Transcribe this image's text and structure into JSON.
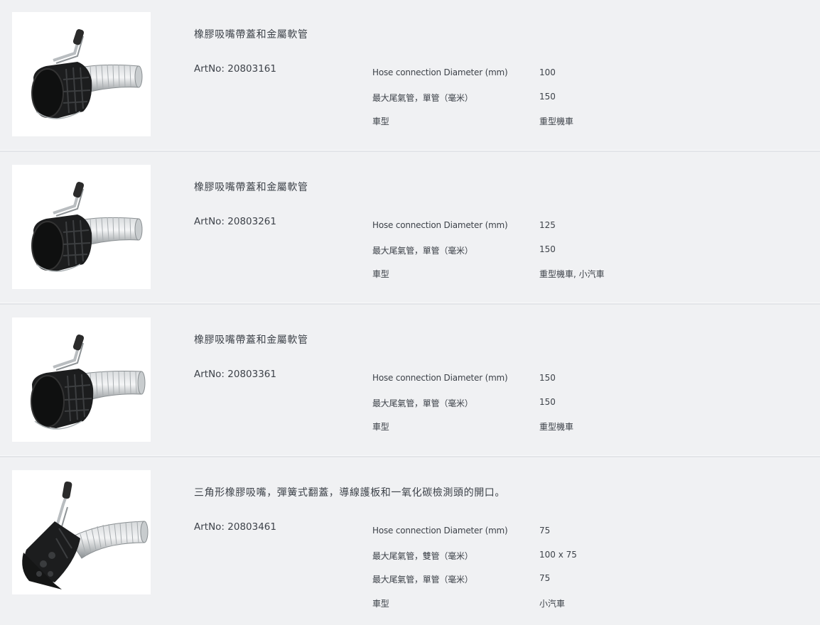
{
  "products": [
    {
      "title": "橡膠吸嘴帶蓋和金屬軟管",
      "artno": "ArtNo: 20803161",
      "image_icon": "rubber-nozzle-with-lid-and-metal-hose-icon",
      "specs": [
        {
          "label": "Hose connection Diameter (mm)",
          "value": "100"
        },
        {
          "label": "最大尾氣管，單管（毫米）",
          "value": "150"
        },
        {
          "label": "車型",
          "value": "重型機車"
        }
      ]
    },
    {
      "title": "橡膠吸嘴帶蓋和金屬軟管",
      "artno": "ArtNo: 20803261",
      "image_icon": "rubber-nozzle-with-lid-and-metal-hose-icon",
      "specs": [
        {
          "label": "Hose connection Diameter (mm)",
          "value": "125"
        },
        {
          "label": "最大尾氣管，單管（毫米）",
          "value": "150"
        },
        {
          "label": "車型",
          "value": "重型機車, 小汽車"
        }
      ]
    },
    {
      "title": "橡膠吸嘴帶蓋和金屬軟管",
      "artno": "ArtNo: 20803361",
      "image_icon": "rubber-nozzle-with-lid-and-metal-hose-icon",
      "specs": [
        {
          "label": "Hose connection Diameter (mm)",
          "value": "150"
        },
        {
          "label": "最大尾氣管，單管（毫米）",
          "value": "150"
        },
        {
          "label": "車型",
          "value": "重型機車"
        }
      ]
    },
    {
      "title": "三角形橡膠吸嘴，彈簧式翻蓋，導線護板和一氧化碳檢測頭的開口。",
      "artno": "ArtNo: 20803461",
      "image_icon": "triangular-rubber-nozzle-with-metal-hose-icon",
      "specs": [
        {
          "label": "Hose connection Diameter (mm)",
          "value": "75"
        },
        {
          "label": "最大尾氣管，雙管（毫米）",
          "value": "100 x 75"
        },
        {
          "label": "最大尾氣管，單管（毫米）",
          "value": "75"
        },
        {
          "label": "車型",
          "value": "小汽車"
        }
      ]
    }
  ]
}
